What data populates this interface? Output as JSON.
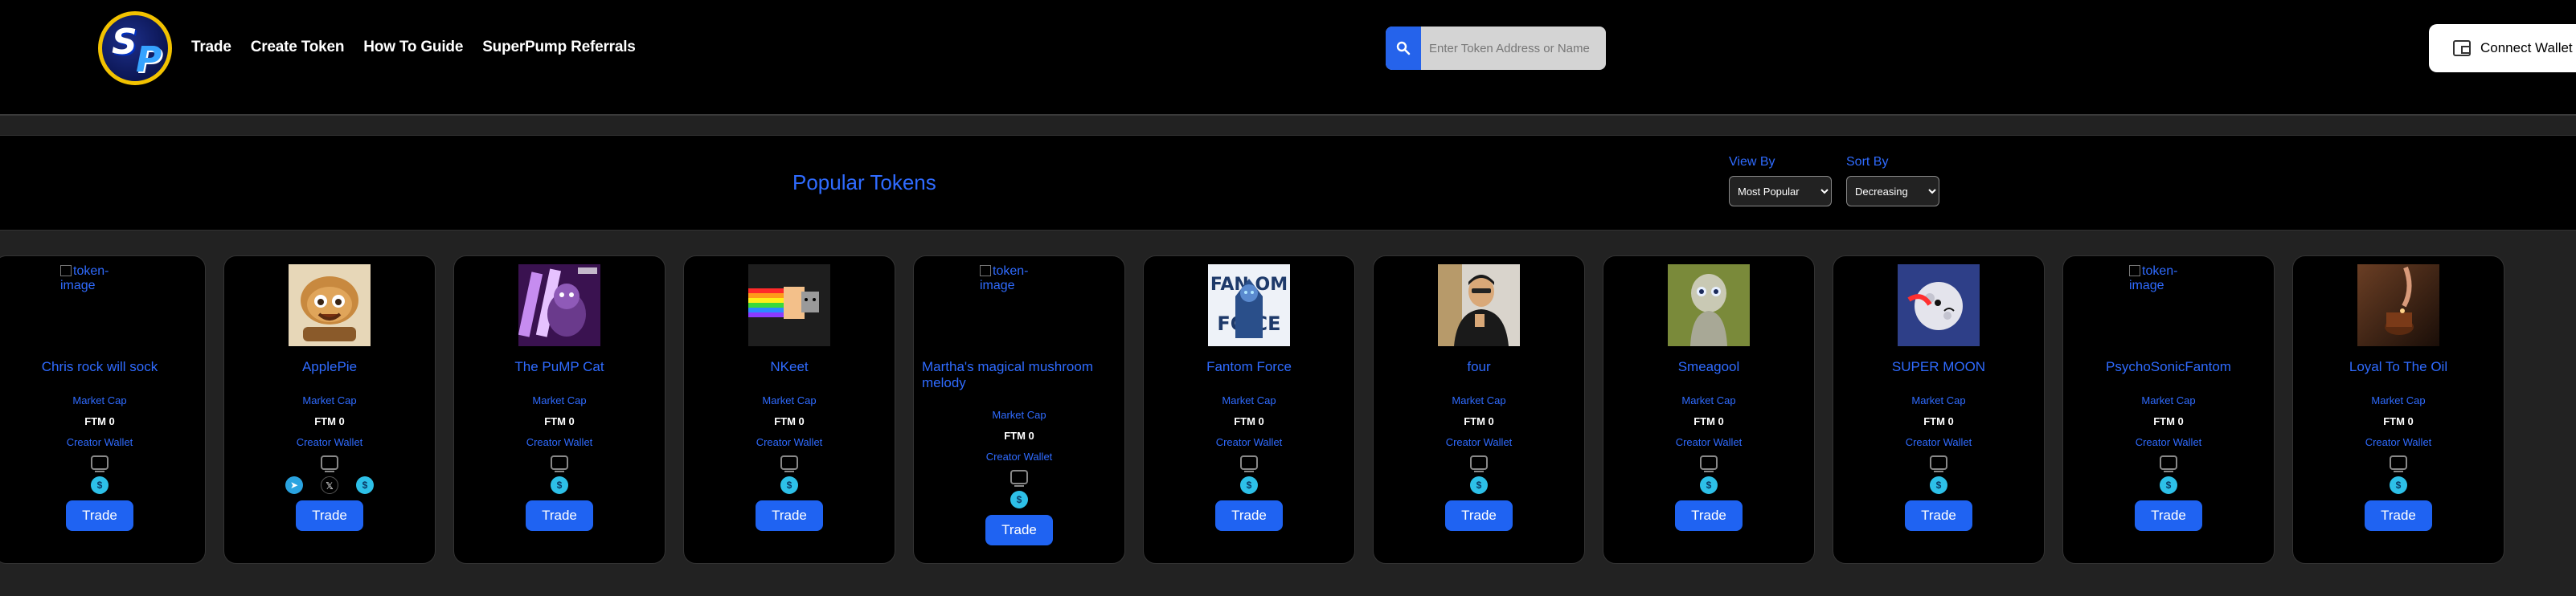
{
  "header": {
    "logo_text_s": "S",
    "logo_text_p": "P",
    "nav": [
      "Trade",
      "Create Token",
      "How To Guide",
      "SuperPump Referrals"
    ],
    "search_placeholder": "Enter Token Address or Name",
    "connect_label": "Connect Wallet"
  },
  "panel": {
    "title": "Popular Tokens",
    "view_by_label": "View By",
    "view_by_value": "Most Popular",
    "sort_by_label": "Sort By",
    "sort_by_value": "Decreasing"
  },
  "broken_image_alt": "token-image",
  "card_labels": {
    "market_cap": "Market Cap",
    "ftm_value": "FTM 0",
    "creator_wallet": "Creator Wallet",
    "trade": "Trade",
    "coin_glyph": "$"
  },
  "tokens": [
    {
      "name": "Chris rock will sock",
      "image": "broken"
    },
    {
      "name": "ApplePie",
      "image": "pie"
    },
    {
      "name": "The PuMP Cat",
      "image": "cat"
    },
    {
      "name": "NKeet",
      "image": "nyan"
    },
    {
      "name": "Martha's magical mushroom melody",
      "image": "broken"
    },
    {
      "name": "Fantom Force",
      "image": "fantom"
    },
    {
      "name": "four",
      "image": "person"
    },
    {
      "name": "Smeagool",
      "image": "smeagol"
    },
    {
      "name": "SUPER MOON",
      "image": "moon"
    },
    {
      "name": "PsychoSonicFantom",
      "image": "broken"
    },
    {
      "name": "Loyal To The Oil",
      "image": "oil"
    }
  ],
  "colors": {
    "accent_blue": "#2f6bff",
    "button_blue": "#1f63f2",
    "background": "#222222",
    "panel_black": "#000000"
  }
}
